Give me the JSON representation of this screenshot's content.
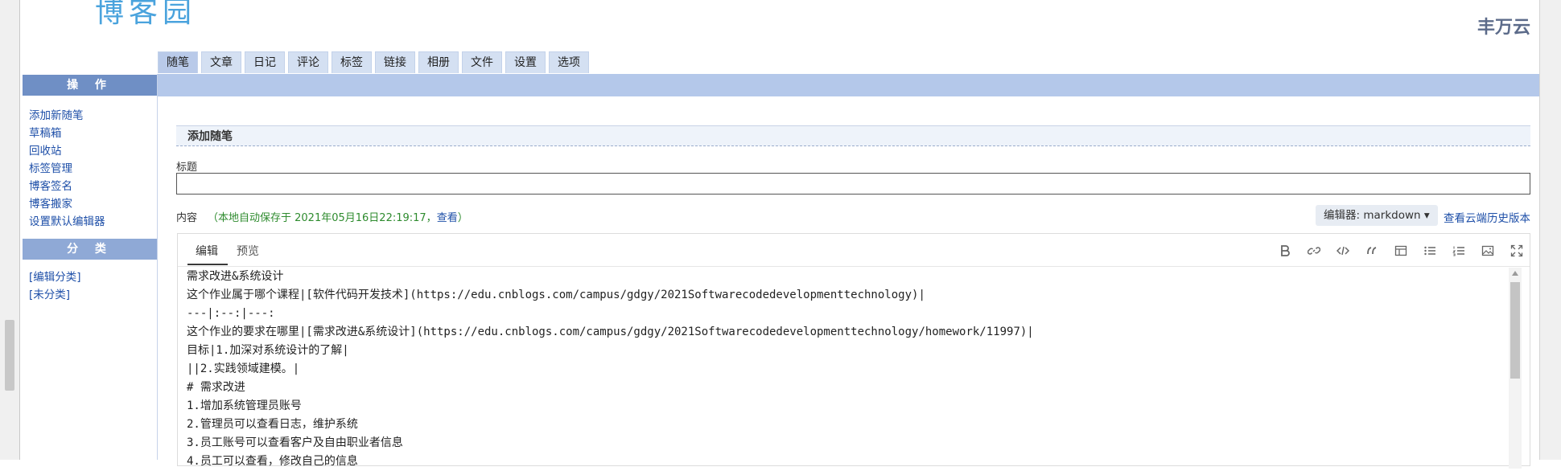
{
  "header": {
    "logo_text": "博客园",
    "username": "丰万云"
  },
  "tabs": [
    {
      "label": "随笔",
      "active": true
    },
    {
      "label": "文章"
    },
    {
      "label": "日记"
    },
    {
      "label": "评论"
    },
    {
      "label": "标签"
    },
    {
      "label": "链接"
    },
    {
      "label": "相册"
    },
    {
      "label": "文件"
    },
    {
      "label": "设置"
    },
    {
      "label": "选项"
    }
  ],
  "sidebar": {
    "ops_title": "操 作",
    "ops_links": [
      "添加新随笔",
      "草稿箱",
      "回收站",
      "标签管理",
      "博客签名",
      "博客搬家",
      "设置默认编辑器"
    ],
    "cat_title": "分 类",
    "cat_links": [
      "[编辑分类]",
      "[未分类]"
    ]
  },
  "main": {
    "section_title": "添加随笔",
    "title_label": "标题",
    "title_value": "",
    "content_label": "内容",
    "autosave_prefix": "（本地自动保存于 2021年05月16日22:19:17，",
    "autosave_view": "查看",
    "autosave_suffix": "）",
    "editor_select": "编辑器: markdown",
    "history_link": "查看云端历史版本"
  },
  "editor": {
    "tab_edit": "编辑",
    "tab_preview": "预览",
    "toolbar_icons": [
      "bold-icon",
      "link-icon",
      "code-icon",
      "quote-icon",
      "table-icon",
      "bulleted-list-icon",
      "numbered-list-icon",
      "image-icon",
      "fullscreen-icon"
    ],
    "lines": [
      "需求改进&系统设计",
      "这个作业属于哪个课程|[软件代码开发技术](https://edu.cnblogs.com/campus/gdgy/2021Softwarecodedevelopmenttechnology)|",
      "---|:--:|---:",
      "这个作业的要求在哪里|[需求改进&系统设计](https://edu.cnblogs.com/campus/gdgy/2021Softwarecodedevelopmenttechnology/homework/11997)|",
      "目标|1.加深对系统设计的了解|",
      "||2.实践领域建模。|",
      "# 需求改进",
      "1.增加系统管理员账号",
      "2.管理员可以查看日志，维护系统",
      "3.员工账号可以查看客户及自由职业者信息",
      "4.员工可以查看，修改自己的信息"
    ]
  },
  "colors": {
    "tab_bg": "#d4e0f2",
    "tab_active_bg": "#b9cae9",
    "bar": "#b4c8ea",
    "sidebar_header": "#6f8fc5",
    "link": "#1e4fa8",
    "autosave_green": "#2e8b2e"
  }
}
